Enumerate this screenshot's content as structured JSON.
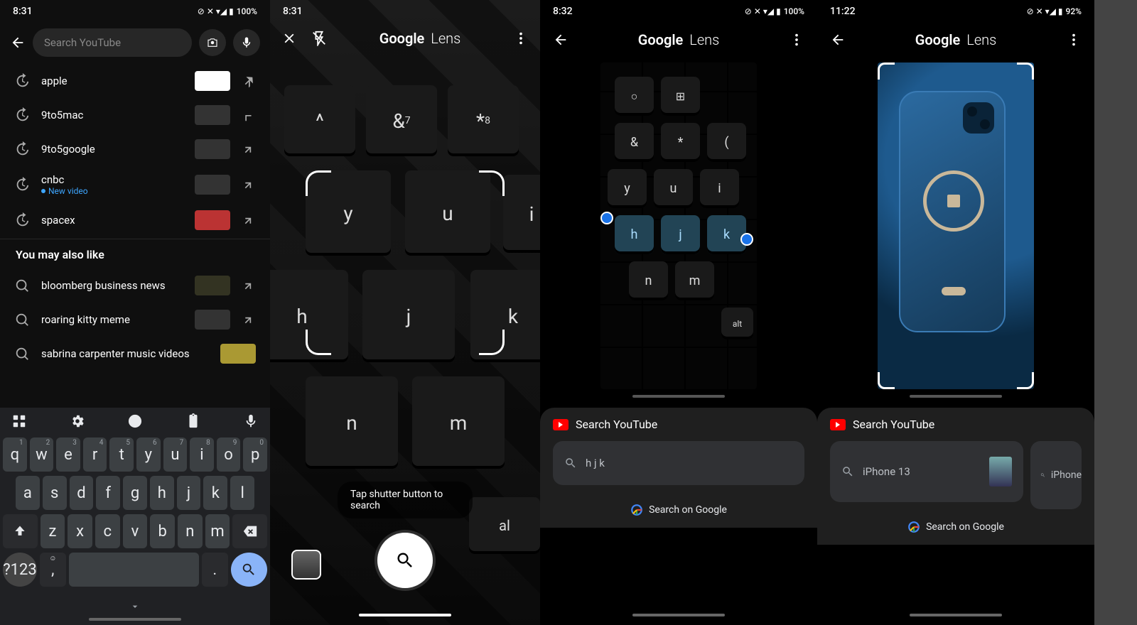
{
  "screen1": {
    "status": {
      "time": "8:31",
      "battery": "100%"
    },
    "search_placeholder": "Search YouTube",
    "history": [
      {
        "label": "apple"
      },
      {
        "label": "9to5mac"
      },
      {
        "label": "9to5google"
      },
      {
        "label": "cnbc",
        "sub": "New video"
      },
      {
        "label": "spacex"
      }
    ],
    "suggest_header": "You may also like",
    "suggestions": [
      {
        "label": "bloomberg business news"
      },
      {
        "label": "roaring kitty meme"
      },
      {
        "label": "sabrina carpenter music videos"
      }
    ],
    "keyboard": {
      "row1": [
        "q",
        "w",
        "e",
        "r",
        "t",
        "y",
        "u",
        "i",
        "o",
        "p"
      ],
      "nums": [
        "1",
        "2",
        "3",
        "4",
        "5",
        "6",
        "7",
        "8",
        "9",
        "0"
      ],
      "row2": [
        "a",
        "s",
        "d",
        "f",
        "g",
        "h",
        "j",
        "k",
        "l"
      ],
      "row3": [
        "z",
        "x",
        "c",
        "v",
        "b",
        "n",
        "m"
      ],
      "numkey": "?123",
      "comma": ",",
      "period": "."
    }
  },
  "screen2": {
    "status": {
      "time": "8:31"
    },
    "title_a": "Google",
    "title_b": "Lens",
    "hint": "Tap shutter button to search"
  },
  "screen3": {
    "status": {
      "time": "8:32",
      "battery": "100%"
    },
    "title_a": "Google",
    "title_b": "Lens",
    "sheet_header": "Search YouTube",
    "result": "h j k",
    "search_google": "Search on Google"
  },
  "screen4": {
    "status": {
      "time": "11:22",
      "battery": "92%"
    },
    "title_a": "Google",
    "title_b": "Lens",
    "sheet_header": "Search YouTube",
    "result": "iPhone 13",
    "result2": "iPhone",
    "search_google": "Search on Google"
  }
}
